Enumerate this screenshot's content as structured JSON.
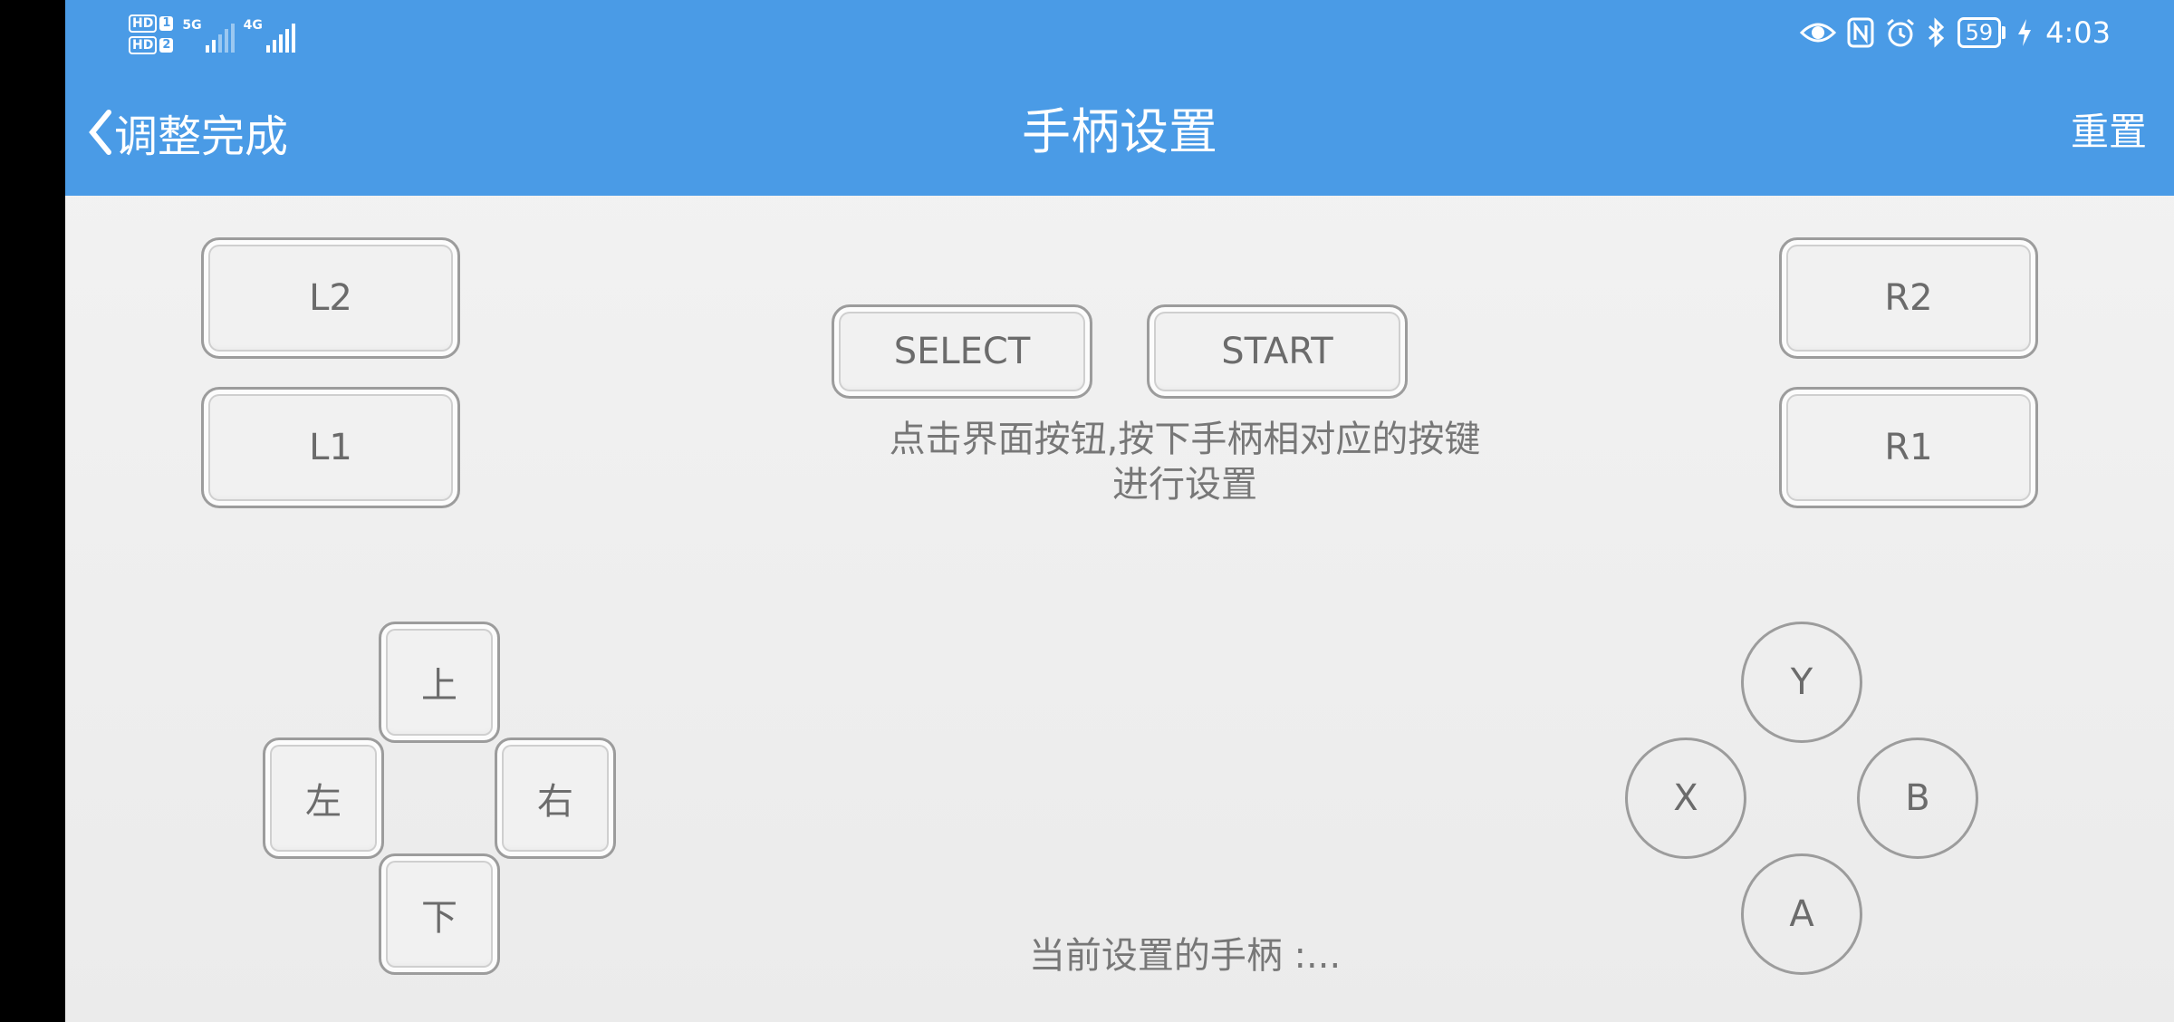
{
  "status_bar": {
    "sim1": {
      "hd": "HD",
      "num": "1",
      "network": "5G"
    },
    "sim2": {
      "hd": "HD",
      "num": "2",
      "network": "4G"
    },
    "battery": "59",
    "time": "4:03"
  },
  "header": {
    "back_label": "调整完成",
    "title": "手柄设置",
    "reset_label": "重置"
  },
  "buttons": {
    "l2": "L2",
    "l1": "L1",
    "r2": "R2",
    "r1": "R1",
    "select": "SELECT",
    "start": "START",
    "up": "上",
    "down": "下",
    "left": "左",
    "right": "右",
    "y": "Y",
    "x": "X",
    "b": "B",
    "a": "A"
  },
  "hint": {
    "line1": "点击界面按钮,按下手柄相对应的按键",
    "line2": "进行设置"
  },
  "current_controller": "当前设置的手柄 :..."
}
